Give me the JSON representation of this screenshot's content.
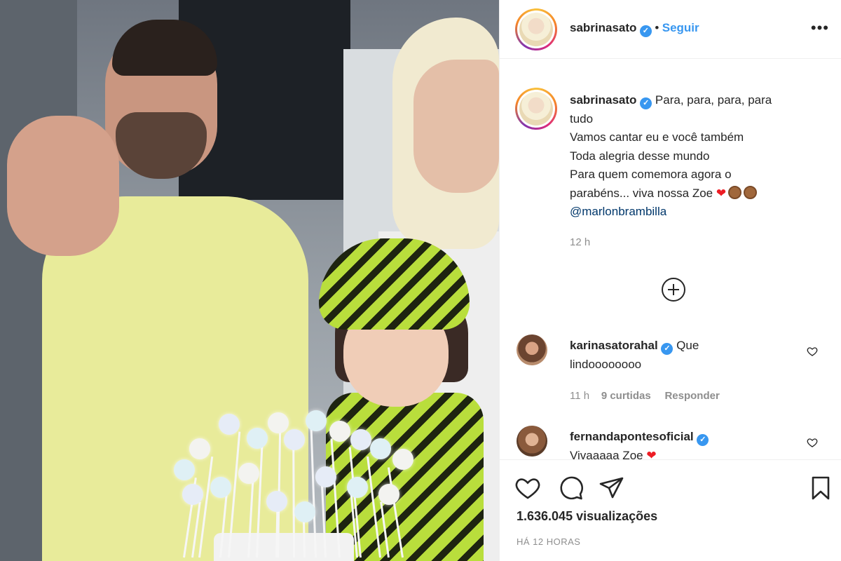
{
  "header": {
    "username": "sabrinasato",
    "separator": "•",
    "follow_label": "Seguir",
    "more_label": "•••"
  },
  "caption": {
    "username": "sabrinasato",
    "lines": [
      "Para, para, para, para",
      "tudo",
      "Vamos cantar eu e você também",
      "Toda alegria desse mundo",
      "Para quem comemora agora o",
      "parabéns... viva nossa Zoe"
    ],
    "heart": "❤",
    "mention": "@marlonbrambilla",
    "time": "12 h"
  },
  "load_more_icon": "plus-circle-icon",
  "comments": [
    {
      "username": "karinasatorahal",
      "text_line1": "Que",
      "text_line2": "lindoooooooo",
      "time": "11 h",
      "likes": "9 curtidas",
      "reply": "Responder"
    },
    {
      "username": "fernandapontesoficial",
      "text_line1": "Vivaaaaa Zoe",
      "heart": "❤"
    }
  ],
  "actions": {
    "like_icon": "heart-icon",
    "comment_icon": "comment-icon",
    "share_icon": "paper-plane-icon",
    "save_icon": "bookmark-icon",
    "views": "1.636.045 visualizações",
    "posted_ago": "HÁ 12 HORAS"
  },
  "colors": {
    "accent": "#3897f0",
    "mention": "#00376b",
    "muted": "#8e8e8e",
    "heart": "#ed1c24"
  }
}
